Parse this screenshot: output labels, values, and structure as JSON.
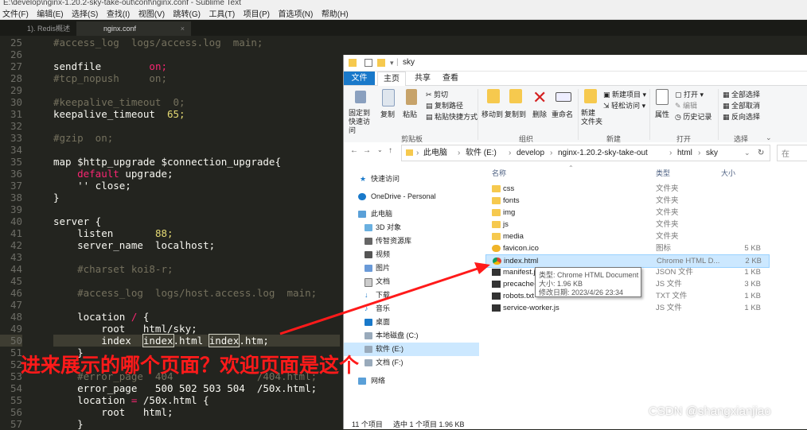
{
  "sublime": {
    "title": "E:\\develop\\nginx-1.20.2-sky-take-out\\conf\\nginx.conf - Sublime Text",
    "menu": [
      "文件(F)",
      "编辑(E)",
      "选择(S)",
      "查找(I)",
      "视图(V)",
      "跳转(G)",
      "工具(T)",
      "项目(P)",
      "首选项(N)",
      "帮助(H)"
    ],
    "tabs": [
      {
        "label": "1). Redis概述"
      },
      {
        "label": "nginx.conf"
      }
    ],
    "close_glyph": "×",
    "line_numbers": [
      "25",
      "26",
      "27",
      "28",
      "29",
      "30",
      "31",
      "32",
      "33",
      "34",
      "35",
      "36",
      "37",
      "38",
      "39",
      "40",
      "41",
      "42",
      "43",
      "44",
      "45",
      "46",
      "47",
      "48",
      "49",
      "50",
      "51",
      "52",
      "53",
      "54",
      "55",
      "56",
      "57"
    ]
  },
  "code": {
    "l25": "#access_log  logs/access.log  main;",
    "l27a": "sendfile        ",
    "l27b": "on;",
    "l28": "#tcp_nopush     on;",
    "l30": "#keepalive_timeout  0;",
    "l31a": "keepalive_timeout  ",
    "l31b": "65;",
    "l33": "#gzip  on;",
    "l35": "map $http_upgrade $connection_upgrade{",
    "l36a": "    ",
    "l36b": "default",
    "l36c": " upgrade;",
    "l37": "    '' close;",
    "l38": "}",
    "l40": "server {",
    "l41a": "    listen       ",
    "l41b": "88;",
    "l42": "    server_name  localhost;",
    "l44": "    #charset koi8-r;",
    "l46": "    #access_log  logs/host.access.log  main;",
    "l48a": "    location ",
    "l48b": "/",
    "l48c": " {",
    "l49": "        root   html/sky;",
    "l50a": "        index  ",
    "l50b": "index",
    "l50c": ".html ",
    "l50d": "index",
    "l50e": ".htm;",
    "l51": "    }",
    "l53": "    #error_page  404              /404.html;",
    "l54": "    error_page   500 502 503 504  /50x.html;",
    "l55a": "    location ",
    "l55b": "=",
    "l55c": " /50x.html {",
    "l56": "        root   html;",
    "l57": "    }"
  },
  "caption": "进来展示的哪个页面？欢迎页面是这个",
  "explorer": {
    "title": "sky",
    "ribbon_tabs": [
      "文件",
      "主页",
      "共享",
      "查看"
    ],
    "clipboard": {
      "pin": "固定到快速访问",
      "copy": "复制",
      "paste": "粘贴",
      "cut": "剪切",
      "copy_path": "复制路径",
      "paste_shortcut": "粘贴快捷方式",
      "label": "剪贴板"
    },
    "organize": {
      "move_to": "移动到",
      "copy_to": "复制到",
      "delete": "删除",
      "rename": "重命名",
      "label": "组织"
    },
    "new": {
      "new_folder": "新建\n文件夹",
      "new_item": "新建项目",
      "easy_access": "轻松访问",
      "label": "新建"
    },
    "open": {
      "properties": "属性",
      "open": "打开",
      "edit": "编辑",
      "history": "历史记录",
      "label": "打开"
    },
    "select": {
      "select_all": "全部选择",
      "select_none": "全部取消",
      "invert": "反向选择",
      "label": "选择"
    },
    "breadcrumb": [
      "此电脑",
      "软件 (E:)",
      "develop",
      "nginx-1.20.2-sky-take-out",
      "html",
      "sky"
    ],
    "search_placeholder": "在",
    "nav": [
      {
        "label": "快速访问"
      },
      {
        "label": "OneDrive - Personal"
      },
      {
        "label": "此电脑"
      },
      {
        "label": "3D 对象"
      },
      {
        "label": "传智资源库"
      },
      {
        "label": "视频"
      },
      {
        "label": "图片"
      },
      {
        "label": "文档"
      },
      {
        "label": "下载"
      },
      {
        "label": "音乐"
      },
      {
        "label": "桌面"
      },
      {
        "label": "本地磁盘 (C:)"
      },
      {
        "label": "软件 (E:)"
      },
      {
        "label": "文档 (F:)"
      },
      {
        "label": "网络"
      }
    ],
    "columns": {
      "name": "名称",
      "type": "类型",
      "size": "大小"
    },
    "files": [
      {
        "name": "css",
        "type": "文件夹",
        "size": ""
      },
      {
        "name": "fonts",
        "type": "文件夹",
        "size": ""
      },
      {
        "name": "img",
        "type": "文件夹",
        "size": ""
      },
      {
        "name": "js",
        "type": "文件夹",
        "size": ""
      },
      {
        "name": "media",
        "type": "文件夹",
        "size": ""
      },
      {
        "name": "favicon.ico",
        "type": "图标",
        "size": "5 KB"
      },
      {
        "name": "index.html",
        "type": "Chrome HTML D...",
        "size": "2 KB"
      },
      {
        "name": "manifest.json",
        "type": "JSON 文件",
        "size": "1 KB"
      },
      {
        "name": "precache-manifest.js",
        "type": "JS 文件",
        "size": "3 KB"
      },
      {
        "name": "robots.txt",
        "type": "TXT 文件",
        "size": "1 KB"
      },
      {
        "name": "service-worker.js",
        "type": "JS 文件",
        "size": "1 KB"
      }
    ],
    "tooltip": {
      "type": "类型: Chrome HTML Document",
      "size": "大小: 1.96 KB",
      "date": "修改日期: 2023/4/26 23:34"
    },
    "status": {
      "count": "11 个项目",
      "selected": "选中 1 个项目  1.96 KB"
    }
  },
  "watermark": "CSDN @shangxianjiao",
  "colors": {
    "comment": "#75715e",
    "string": "#e6db74",
    "keyword": "#f92672",
    "caption": "#ff1a1a",
    "accent": "#1979ca"
  }
}
